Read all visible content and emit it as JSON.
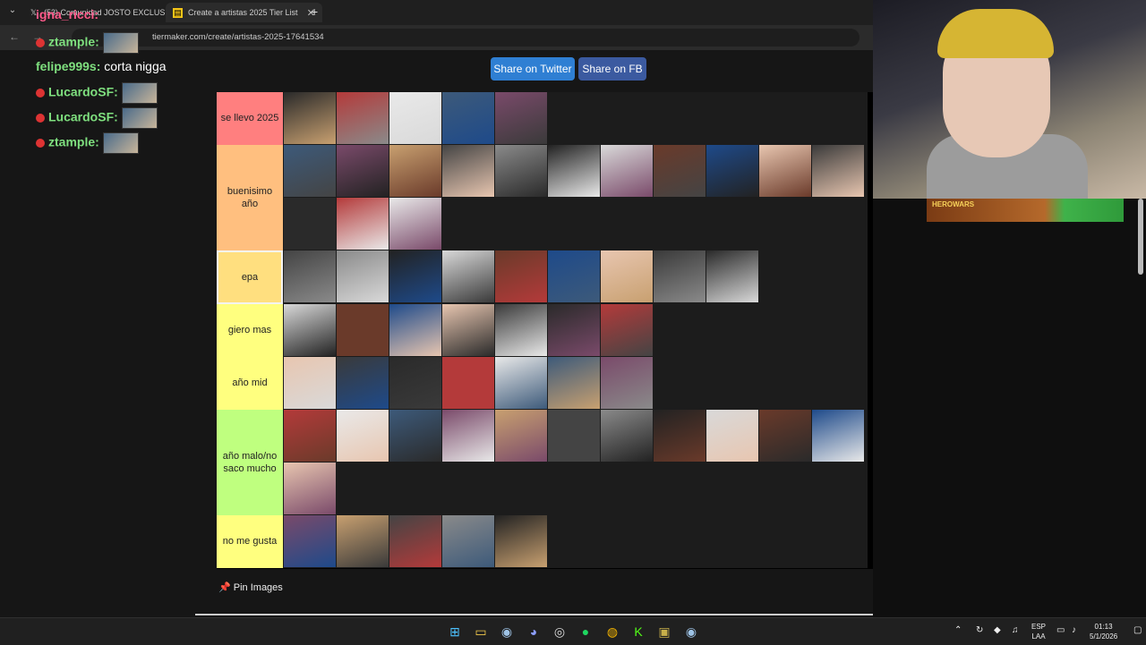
{
  "browser": {
    "tabs": [
      {
        "title": "(53) Comunidad JOSTO EXCLUS",
        "icon": "x-logo-icon",
        "active": false
      },
      {
        "title": "Create a artistas 2025 Tier List",
        "icon": "tiermaker-icon",
        "active": true
      }
    ],
    "url": "tiermaker.com/create/artistas-2025-17641534",
    "url_partial_left": "tier",
    "new_tab": "+",
    "close": "✕"
  },
  "share": {
    "twitter": "Share on Twitter",
    "facebook": "Share on FB"
  },
  "tiers": [
    {
      "label": "se llevo 2025",
      "color": "#ff7f7f",
      "count": 5
    },
    {
      "label": "buenisimo año",
      "color": "#ffbf7f",
      "count": 14
    },
    {
      "label": "epa",
      "color": "#ffdf7f",
      "count": 9,
      "selected": true
    },
    {
      "label": "giero mas",
      "color": "#ffff7f",
      "count": 7
    },
    {
      "label": "año mid",
      "color": "#ffff7f",
      "count": 7
    },
    {
      "label": "año malo/no saco mucho",
      "color": "#bfff7f",
      "count": 12
    },
    {
      "label": "no me gusta",
      "color": "#ffff7f",
      "count": 5
    }
  ],
  "pin_images": "Pin Images",
  "chat": [
    {
      "user": "igna_ricci:",
      "text": "",
      "badge": false,
      "emote": false
    },
    {
      "user": "ztample:",
      "text": "",
      "badge": true,
      "emote": true
    },
    {
      "user": "felipe999s:",
      "text": " corta nigga",
      "badge": false,
      "emote": false
    },
    {
      "user": "LucardoSF:",
      "text": "",
      "badge": true,
      "emote": true
    },
    {
      "user": "LucardoSF:",
      "text": "",
      "badge": true,
      "emote": true
    },
    {
      "user": "ztample:",
      "text": "",
      "badge": true,
      "emote": true
    }
  ],
  "ad": {
    "text": "HEROWARS"
  },
  "taskbar": {
    "lang": "ESP",
    "layout": "LAA",
    "time": "01:13",
    "date": "5/1/2026",
    "icons": [
      "windows-start-icon",
      "file-explorer-icon",
      "steam-icon",
      "discord-icon",
      "obs-icon",
      "spotify-icon",
      "chrome-icon",
      "kick-icon",
      "game-icon",
      "steam-icon-2"
    ]
  },
  "colors": {
    "tw": "#2f7fd3",
    "fb": "#3b5aa0"
  }
}
